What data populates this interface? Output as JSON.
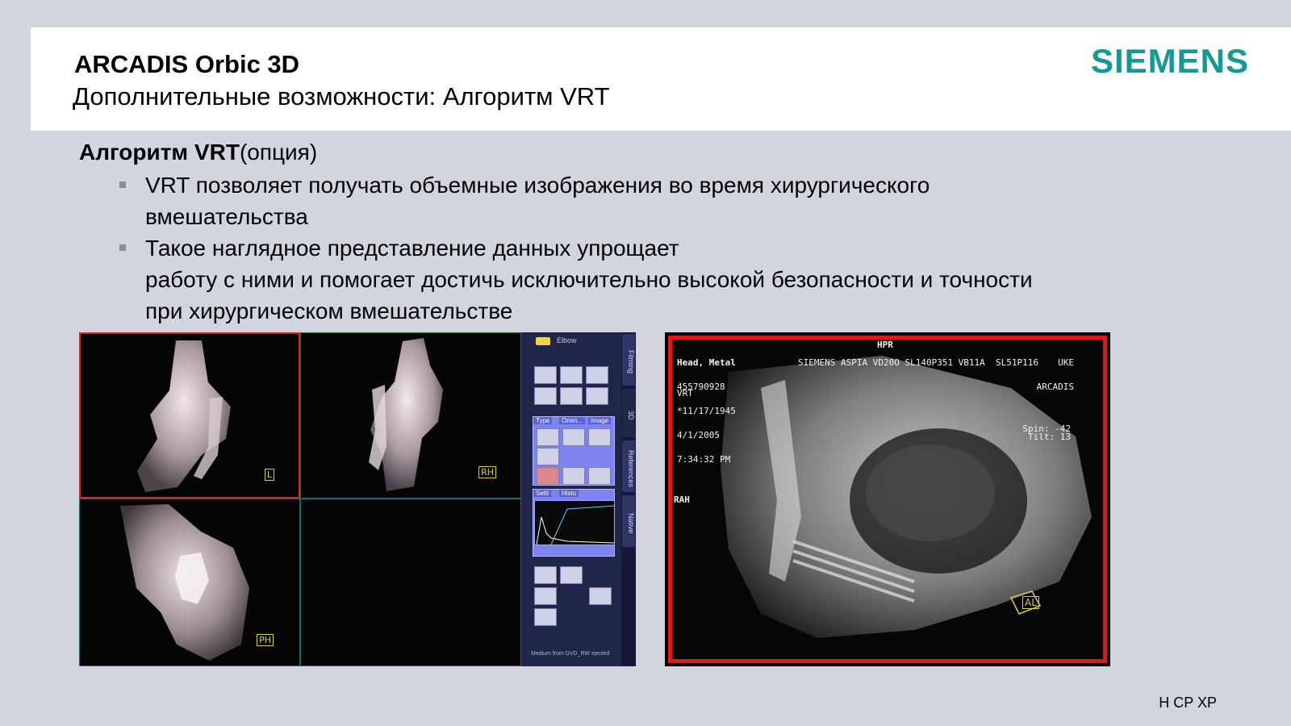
{
  "header": {
    "title": "ARCADIS Orbic 3D",
    "subtitle": "Дополнительные возможности: Алгоритм VRT",
    "logo": "SIEMENS"
  },
  "section": {
    "heading_bold": "Алгоритм VRT",
    "heading_rest": "(опция)",
    "bullets": [
      {
        "lines": [
          "VRT позволяет получать объемные изображения во время хирургического",
          "вмешательства"
        ]
      },
      {
        "lines": [
          "Такое наглядное представление данных упрощает",
          "работу с ними и помогает достичь исключительно высокой безопасности и точности",
          "при хирургическом вмешательстве"
        ]
      }
    ]
  },
  "left_figure": {
    "panel_folder_label": "Elbow",
    "vertical_tabs": [
      "Filming",
      "3D",
      "References",
      "Native"
    ],
    "mini_tabs": [
      "Type",
      "Orien...",
      "Image"
    ],
    "settings_tabs": [
      "Setti",
      "Histo"
    ],
    "status_text": "Medium from DVD_RW ejected",
    "orientation_markers": [
      "L",
      "RH",
      "PH"
    ]
  },
  "right_figure": {
    "overlay_top_left": [
      "Head, Metal",
      "455790928",
      "*11/17/1945",
      "4/1/2005",
      "7:34:32 PM"
    ],
    "overlay_mode": "VRT",
    "overlay_top_center": "HPR",
    "overlay_top_right": [
      "UKE",
      "ARCADIS"
    ],
    "overlay_device": "SIEMENS ASPIA VD20O SL140P351 VB11A  SL51P116",
    "overlay_spin": "Spin: -42",
    "overlay_tilt": "Tilt: 13",
    "overlay_side": "RAH",
    "orientation_cube": "AL"
  },
  "footer": {
    "text": "H CP XP"
  }
}
